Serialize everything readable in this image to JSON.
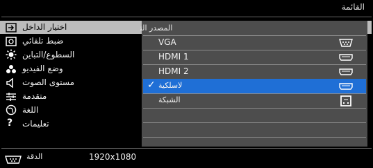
{
  "title": "القائمة",
  "menu": {
    "items": [
      {
        "label": "اختيار الداخل",
        "icon": "input-select-icon",
        "selected": true
      },
      {
        "label": "ضبط تلقائي",
        "icon": "auto-adjust-icon",
        "selected": false
      },
      {
        "label": "السطوع/التباين",
        "icon": "brightness-icon",
        "selected": false
      },
      {
        "label": "وضع الفيديو",
        "icon": "video-mode-icon",
        "selected": false
      },
      {
        "label": "مستوى الصوت",
        "icon": "speaker-icon",
        "selected": false
      },
      {
        "label": "متقدمة",
        "icon": "advanced-settings-icon",
        "selected": false
      },
      {
        "label": "اللغة",
        "icon": "language-globe-icon",
        "selected": false
      },
      {
        "label": "تعليمات",
        "icon": "help-question-icon",
        "selected": false
      }
    ]
  },
  "submenu": {
    "header": "المصدر التلقائي",
    "rows": [
      {
        "label": "VGA",
        "icon": "vga-port-icon",
        "active": false
      },
      {
        "label": "HDMI 1",
        "icon": "hdmi-port-icon",
        "active": false
      },
      {
        "label": "HDMI 2",
        "icon": "hdmi-port-icon",
        "active": false
      },
      {
        "label": "لاسلكية",
        "icon": "hdmi-port-icon",
        "active": true
      },
      {
        "label": "الشبكة",
        "icon": "network-icon",
        "active": false
      }
    ]
  },
  "footer": {
    "label": "الدقة",
    "resolution": "1920x1080"
  },
  "colors": {
    "highlight": "#1f6fd6",
    "panel": "#4d4d4d",
    "selected_menu": "#bcbcbc"
  }
}
